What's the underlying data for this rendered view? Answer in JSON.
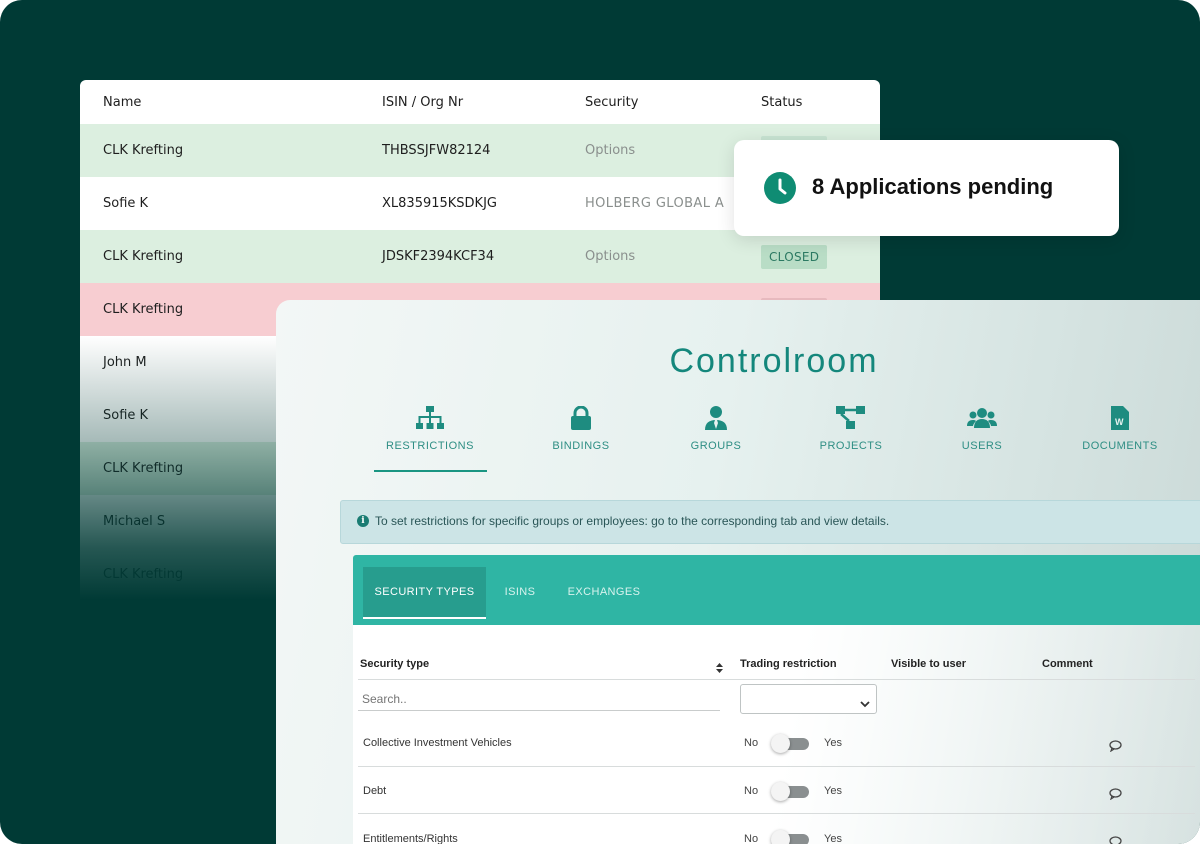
{
  "background_table": {
    "headers": {
      "name": "Name",
      "isin": "ISIN / Org Nr",
      "security": "Security",
      "status": "Status"
    },
    "rows": [
      {
        "name": "CLK Krefting",
        "isin": "THBSSJFW82124",
        "security": "Options",
        "status": ""
      },
      {
        "name": "Sofie K",
        "isin": "XL835915KSDKJG",
        "security": "HOLBERG GLOBAL A",
        "status": ""
      },
      {
        "name": "CLK Krefting",
        "isin": "JDSKF2394KCF34",
        "security": "Options",
        "status": "CLOSED"
      },
      {
        "name": "CLK Krefting",
        "isin": "",
        "security": "",
        "status": ""
      },
      {
        "name": "John M",
        "isin": "",
        "security": "",
        "status": ""
      },
      {
        "name": "Sofie K",
        "isin": "",
        "security": "",
        "status": ""
      },
      {
        "name": "CLK Krefting",
        "isin": "",
        "security": "",
        "status": ""
      },
      {
        "name": "Michael S",
        "isin": "",
        "security": "",
        "status": ""
      },
      {
        "name": "CLK Krefting",
        "isin": "",
        "security": "",
        "status": ""
      }
    ]
  },
  "notification": {
    "text": "8 Applications pending",
    "icon": "clock-icon"
  },
  "controlroom": {
    "title": "Controlroom",
    "nav_tabs": [
      {
        "label": "RESTRICTIONS",
        "icon": "sitemap-icon",
        "active": true
      },
      {
        "label": "BINDINGS",
        "icon": "lock-icon"
      },
      {
        "label": "GROUPS",
        "icon": "user-tie-icon"
      },
      {
        "label": "PROJECTS",
        "icon": "project-diagram-icon"
      },
      {
        "label": "USERS",
        "icon": "users-icon"
      },
      {
        "label": "DOCUMENTS",
        "icon": "word-document-icon"
      }
    ],
    "info_text": "To set restrictions for specific groups or employees: go to the corresponding tab and view details.",
    "sub_tabs": [
      {
        "label": "SECURITY TYPES",
        "active": true
      },
      {
        "label": "ISINS"
      },
      {
        "label": "EXCHANGES"
      }
    ],
    "grid": {
      "headers": {
        "security_type": "Security type",
        "trading_restriction": "Trading restriction",
        "visible_to_user": "Visible to user",
        "comment": "Comment"
      },
      "search_placeholder": "Search..",
      "toggle_no": "No",
      "toggle_yes": "Yes",
      "rows": [
        {
          "name": "Collective Investment Vehicles"
        },
        {
          "name": "Debt"
        },
        {
          "name": "Entitlements/Rights"
        }
      ]
    }
  },
  "colors": {
    "background": "#003a35",
    "accent": "#14877c",
    "subtab_bar": "#2fb5a4",
    "row_green": "#dcefe0",
    "row_red": "#f7cdd1"
  }
}
